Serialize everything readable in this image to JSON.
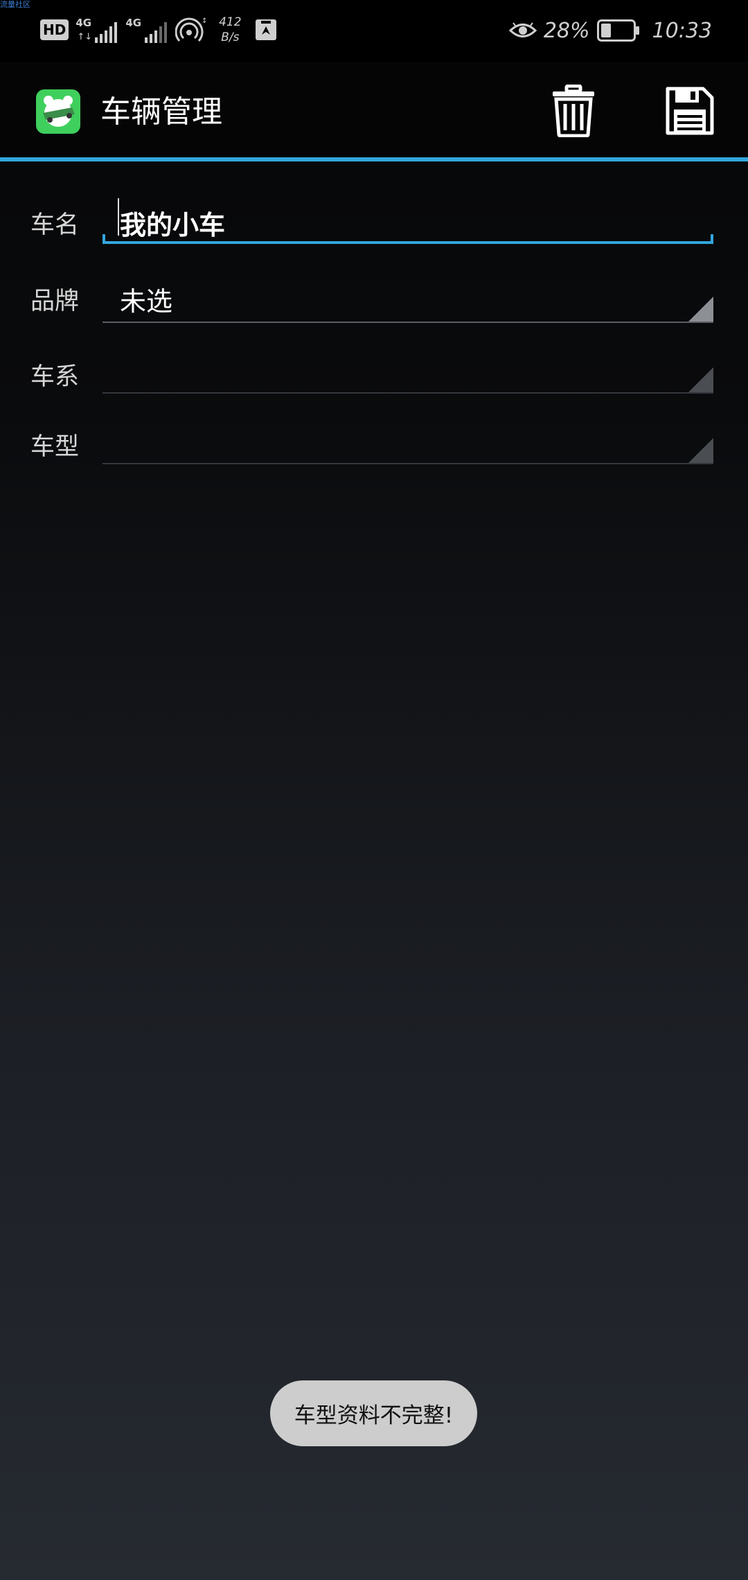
{
  "status_bar": {
    "watermark": "流量社区",
    "hd_label": "HD",
    "network1": "4G",
    "network2": "4G",
    "net_speed_value": "412",
    "net_speed_unit": "B/s",
    "battery_percent": "28%",
    "time": "10:33",
    "icons": [
      "hd-icon",
      "signal-icon",
      "signal-icon",
      "hotspot-icon",
      "huawei-icon",
      "eye-comfort-icon",
      "battery-icon"
    ]
  },
  "toolbar": {
    "title": "车辆管理",
    "app_icon": "car-app-icon",
    "delete_icon": "trash-icon",
    "save_icon": "save-icon",
    "accent_color": "#33a6dd"
  },
  "form": {
    "name": {
      "label": "车名",
      "value": "我的小车"
    },
    "brand": {
      "label": "品牌",
      "value": "未选"
    },
    "series": {
      "label": "车系",
      "value": ""
    },
    "model": {
      "label": "车型",
      "value": ""
    }
  },
  "toast": {
    "message": "车型资料不完整!"
  }
}
